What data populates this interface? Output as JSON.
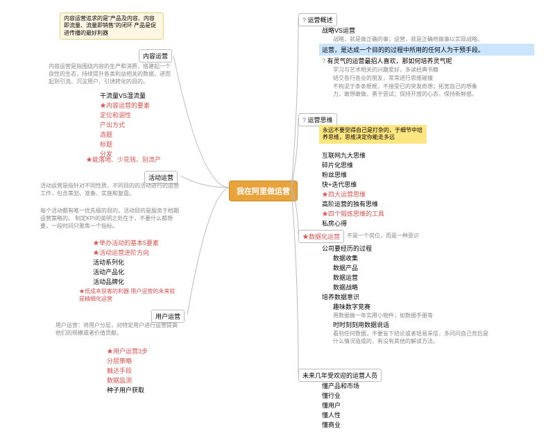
{
  "root": "我在阿里做运营",
  "left": {
    "content_ops": {
      "title": "内容运营",
      "callout": "内容运营追求的是\"产品及内容、内容即流量、流量即销售\"的闭环\n产品是促进传播的最好利器",
      "desc": "内容运营是指围绕内容的生产和消费，搭建起一个良性的生态，持续提升各类利益相关的数据，进而起到引流、沉淀用户、引诱转化的目的。",
      "items": [
        "干流量VS湿流量",
        "★内容运营的要素",
        "定位和调性",
        "产出方式",
        "选题",
        "标题",
        "分发"
      ]
    },
    "activity_ops": {
      "title": "活动运营",
      "star_note": "★能落地、少花钱、别流产",
      "desc": "活动运营是指针对不同性质、不同目的的活动进行的运营工作，包含策划、准备、实施和复盘。",
      "desc2": "每个活动都有唯一优先级的目的，活动目的是服务于档期运营策略的。\n制定KPI的英明之处在于，不要什么都想要，一段时间只聚焦一个指标。",
      "items": [
        "★举办活动的基本5要素",
        "★活动运营进阶方向",
        "活动系列化",
        "活动产品化",
        "活动品牌化"
      ]
    },
    "user_ops": {
      "title": "用户运营",
      "star_note": "★低成本获客的利器\n用户运营的未来就是精细化运营",
      "desc": "用户运营：将用户分层，对特定用户进行运营提高他们的规模或者价值贡献。",
      "items": [
        "★用户运营3步",
        "分层策略",
        "触达手段",
        "数据监测",
        "种子用户获取"
      ]
    }
  },
  "right": {
    "overview": {
      "title": "运营概述",
      "items": [
        "战略VS运营",
        "战略，就是做正确的事；运营，就是正确地做事以实现战略。",
        "运营，是达成一个目的的过程中所用的任何人为干预手段。",
        "有灵气的运营最招人喜欢，那如何培养灵气呢",
        "学习与艺术相关的兴趣爱好，多读经典书籍",
        "结交各行各业的朋友，常常进行思维碰撞",
        "不拘泥于条条框框，不接受已的突发奇想；拓宽自己的想象力，敢想敢做，勇于尝试；保持开放的心态，保持新鲜感。"
      ]
    },
    "thinking": {
      "title": "运营思维",
      "highlight": "永远不要觉得自己是打杂的，于细节中培养思维，思维决定你能走多远",
      "items": [
        "互联网九大思维",
        "碎片化思维",
        "粉丝思维",
        "快+迭代思维",
        "★四大运营思维",
        "高阶运营的独有思维",
        "★四个锻炼思维的工具",
        "私房心得"
      ]
    },
    "data_ops": {
      "title": "★数据化运营",
      "subtitle": "不是一个岗位，而是一种意识",
      "group1_title": "公司要经历的过程",
      "group1": [
        "数据收集",
        "数据产品",
        "数据运营",
        "数据战略"
      ],
      "group2_title": "培养数据意识",
      "group2": [
        "趣味数字竞赛",
        "用数据做一年实用小物件；如数据手册等",
        "时时刻刻用数据说话",
        "看到任何数据，不要妄下结论或者轻易采信，多问问自己背后是什么情况造成的，有没有其他的解读方法。"
      ]
    },
    "future": {
      "title": "未来几年受欢迎的运营人员",
      "items": [
        "懂产品和市场",
        "懂行业",
        "懂用户",
        "懂人性",
        "懂商业"
      ]
    }
  }
}
